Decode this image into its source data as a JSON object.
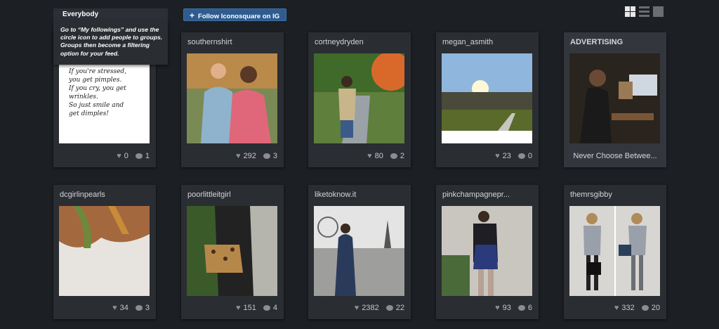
{
  "header": {
    "group_label": "Everybody",
    "tooltip": "Go to “My followings” and use the circle icon to add people to groups. Groups then become a filtering option for your feed.",
    "follow_button": "Follow Iconosquare on IG",
    "view_icons": [
      "grid-view-icon",
      "list-view-icon",
      "single-view-icon"
    ]
  },
  "first_card_note": {
    "text": "If you're stressed,\nyou get pimples.\nIf you cry, you get\nwrinkles.\nSo just smile and\nget dimples!"
  },
  "row1": [
    {
      "user": "",
      "likes": "0",
      "comments": "1"
    },
    {
      "user": "southernshirt",
      "likes": "292",
      "comments": "3"
    },
    {
      "user": "cortneydryden",
      "likes": "80",
      "comments": "2"
    },
    {
      "user": "megan_asmith",
      "likes": "23",
      "comments": "0"
    }
  ],
  "advertising": {
    "label": "ADVERTISING",
    "caption": "Never Choose Betwee..."
  },
  "row2": [
    {
      "user": "dcgirlinpearls",
      "likes": "34",
      "comments": "3"
    },
    {
      "user": "poorlittleitgirl",
      "likes": "151",
      "comments": "4"
    },
    {
      "user": "liketoknow.it",
      "likes": "2382",
      "comments": "22"
    },
    {
      "user": "pinkchampagnepr...",
      "likes": "93",
      "comments": "6"
    },
    {
      "user": "themrsgibby",
      "likes": "332",
      "comments": "20"
    }
  ]
}
